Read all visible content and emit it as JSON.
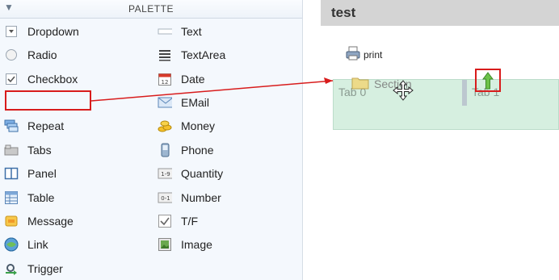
{
  "palette": {
    "title": "PALETTE",
    "left_items": [
      {
        "label": "Dropdown",
        "icon": "dropdown-icon"
      },
      {
        "label": "Radio",
        "icon": "radio-icon"
      },
      {
        "label": "Checkbox",
        "icon": "checkbox-icon"
      },
      {
        "label": "",
        "icon": ""
      },
      {
        "label": "Repeat",
        "icon": "repeat-icon"
      },
      {
        "label": "Tabs",
        "icon": "tabs-icon"
      },
      {
        "label": "Panel",
        "icon": "panel-icon"
      },
      {
        "label": "Table",
        "icon": "table-icon"
      },
      {
        "label": "Message",
        "icon": "message-icon"
      },
      {
        "label": "Link",
        "icon": "link-icon"
      },
      {
        "label": "Trigger",
        "icon": "trigger-icon"
      }
    ],
    "right_items": [
      {
        "label": "Text",
        "icon": "text-icon"
      },
      {
        "label": "TextArea",
        "icon": "textarea-icon"
      },
      {
        "label": "Date",
        "icon": "calendar-icon"
      },
      {
        "label": "EMail",
        "icon": "email-icon"
      },
      {
        "label": "Money",
        "icon": "money-icon"
      },
      {
        "label": "Phone",
        "icon": "phone-icon"
      },
      {
        "label": "Quantity",
        "icon": "quantity-icon"
      },
      {
        "label": "Number",
        "icon": "number-icon"
      },
      {
        "label": "T/F",
        "icon": "true-false-icon"
      },
      {
        "label": "Image",
        "icon": "image-icon"
      }
    ]
  },
  "canvas": {
    "title": "test",
    "print_label": "print",
    "tabs": [
      "Tab 0",
      "Tab 1"
    ],
    "dragging_label": "Section"
  },
  "colors": {
    "highlight": "#d81c1c",
    "tabs_bg": "#d6efe0",
    "header_bg": "#d4d4d4",
    "palette_bg": "#f4f8fd"
  }
}
